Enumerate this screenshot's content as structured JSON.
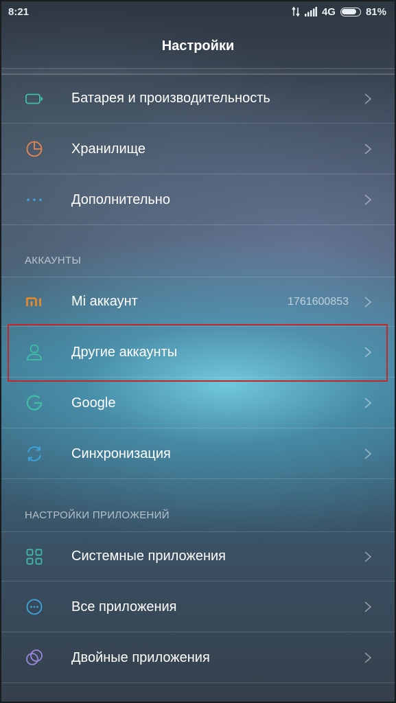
{
  "status_bar": {
    "time": "8:21",
    "network": "4G",
    "battery_percent": "81%",
    "battery_level": 0.81
  },
  "header": {
    "title": "Настройки"
  },
  "groups": {
    "device": {
      "items": [
        {
          "label": "Батарея и производительность",
          "icon": "battery-icon",
          "color": "#3fbfa5"
        },
        {
          "label": "Хранилище",
          "icon": "pie-chart-icon",
          "color": "#e8864f"
        },
        {
          "label": "Дополнительно",
          "icon": "more-dots-icon",
          "color": "#3aa7e0"
        }
      ]
    },
    "accounts": {
      "header": "АККАУНТЫ",
      "items": [
        {
          "label": "Mi аккаунт",
          "value": "1761600853",
          "icon": "mi-logo-icon",
          "color": "#f08a24"
        },
        {
          "label": "Другие аккаунты",
          "icon": "person-icon",
          "color": "#3fbfa5"
        },
        {
          "label": "Google",
          "icon": "google-icon",
          "color": "#3fbfa5"
        },
        {
          "label": "Синхронизация",
          "icon": "sync-icon",
          "color": "#3aa7e0"
        }
      ]
    },
    "app_settings": {
      "header": "НАСТРОЙКИ ПРИЛОЖЕНИЙ",
      "items": [
        {
          "label": "Системные приложения",
          "icon": "app-grid-icon",
          "color": "#3fbfa5"
        },
        {
          "label": "Все приложения",
          "icon": "all-apps-icon",
          "color": "#3aa7e0"
        },
        {
          "label": "Двойные приложения",
          "icon": "dual-apps-icon",
          "color": "#9a88e0"
        }
      ]
    }
  },
  "highlight_color": "#c0282d"
}
